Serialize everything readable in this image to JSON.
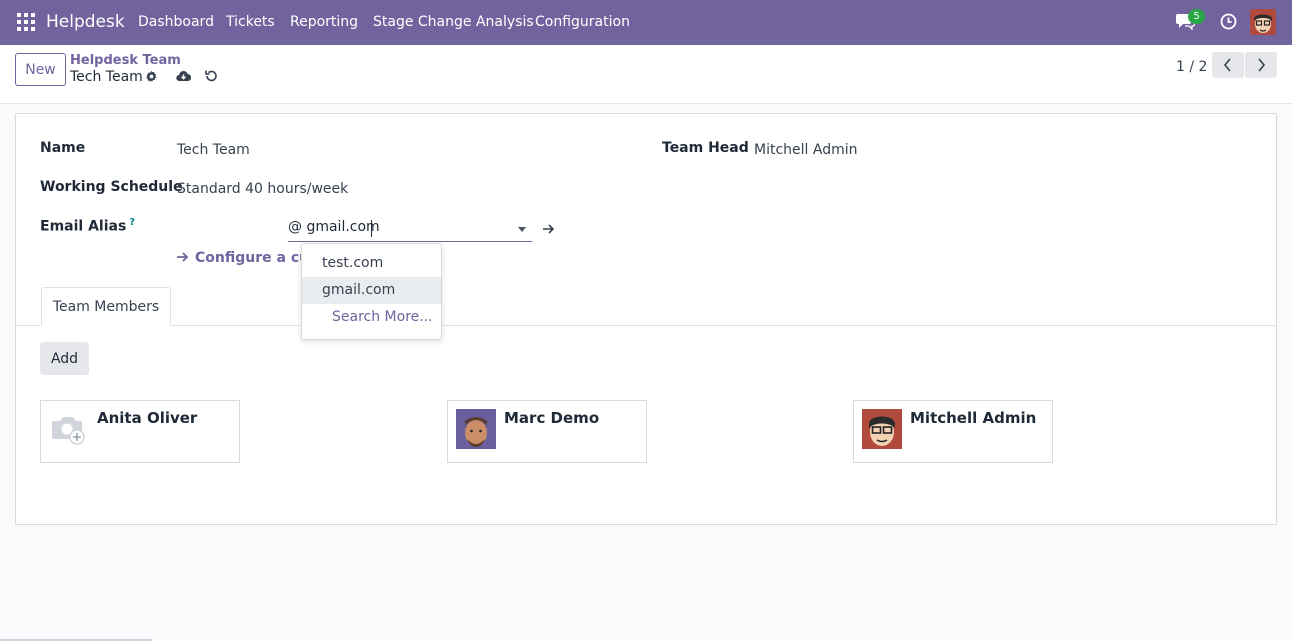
{
  "navbar": {
    "brand": "Helpdesk",
    "menu": [
      "Dashboard",
      "Tickets",
      "Reporting",
      "Stage Change Analysis",
      "Configuration"
    ],
    "chat_count": "5",
    "bg_color": "#71639e"
  },
  "control": {
    "new_label": "New",
    "breadcrumb_parent": "Helpdesk Team",
    "breadcrumb_current": "Tech Team",
    "pager": "1 / 2"
  },
  "form": {
    "name_label": "Name",
    "name_value": "Tech Team",
    "schedule_label": "Working Schedule",
    "schedule_value": "Standard 40 hours/week",
    "alias_label": "Email Alias",
    "alias_help": "?",
    "alias_value": "@ gmail.com",
    "configure_link": "Configure a custom domain",
    "team_head_label": "Team Head",
    "team_head_value": "Mitchell Admin"
  },
  "tabs": {
    "team_members": "Team Members"
  },
  "members": {
    "add_label": "Add",
    "cards": [
      {
        "name": "Anita Oliver"
      },
      {
        "name": "Marc Demo"
      },
      {
        "name": "Mitchell Admin"
      }
    ]
  },
  "autocomplete": {
    "options": [
      "test.com",
      "gmail.com"
    ],
    "search_more": "Search More..."
  }
}
